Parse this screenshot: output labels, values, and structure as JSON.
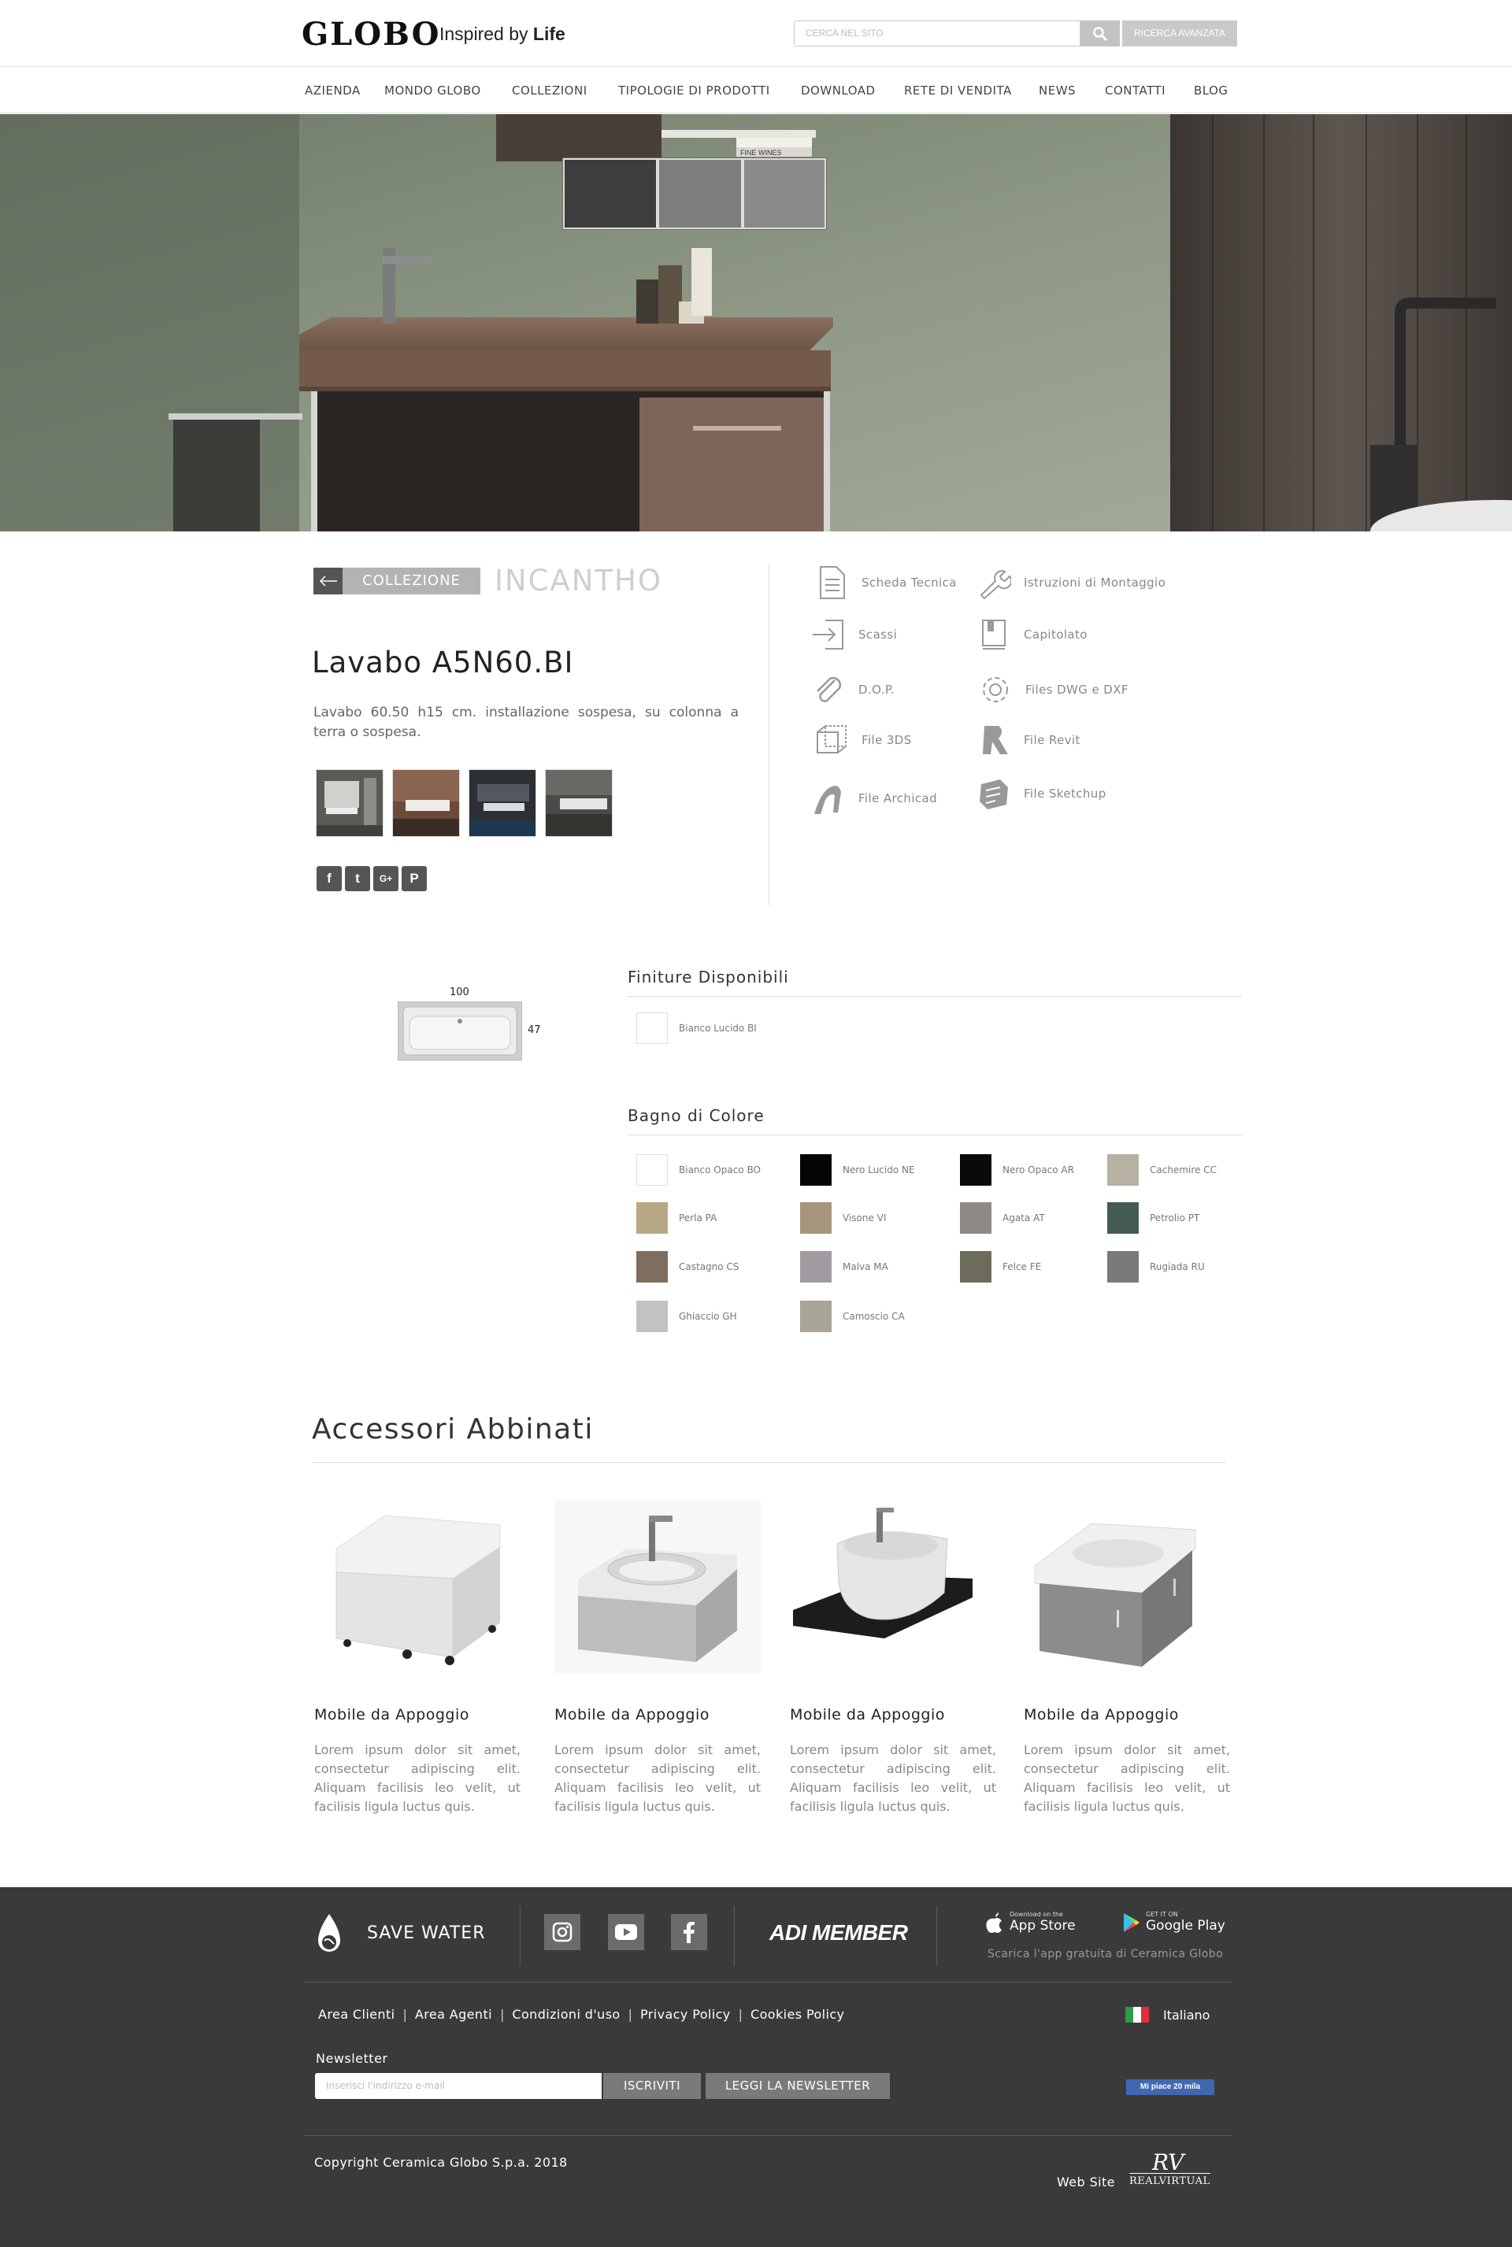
{
  "header": {
    "logo": "GLOBO",
    "tagline_prefix": "Inspired by",
    "tagline_bold": "Life",
    "search_placeholder": "CERCA NEL SITO",
    "advanced_search": "RICERCA AVANZATA"
  },
  "nav": {
    "items": [
      "AZIENDA",
      "MONDO GLOBO",
      "COLLEZIONI",
      "TIPOLOGIE DI PRODOTTI",
      "DOWNLOAD",
      "RETE DI VENDITA",
      "NEWS",
      "CONTATTI",
      "BLOG"
    ]
  },
  "hero": {
    "book_label": "FINE WINES"
  },
  "product": {
    "collection_label": "COLLEZIONE",
    "collection_name": "INCANTHO",
    "title": "Lavabo A5N60.BI",
    "description": "Lavabo 60.50 h15 cm. installazione sospesa, su colonna a terra o sospesa.",
    "share": [
      "f",
      "t",
      "G+",
      "P"
    ]
  },
  "downloads": {
    "items": [
      {
        "label": "Scheda Tecnica",
        "icon": "document-icon"
      },
      {
        "label": "Istruzioni di Montaggio",
        "icon": "wrench-icon"
      },
      {
        "label": "Scassi",
        "icon": "login-arrow-icon"
      },
      {
        "label": "Capitolato",
        "icon": "book-icon"
      },
      {
        "label": "D.O.P.",
        "icon": "paperclip-icon"
      },
      {
        "label": "Files DWG e DXF",
        "icon": "gear-icon"
      },
      {
        "label": "File 3DS",
        "icon": "cube-icon"
      },
      {
        "label": "File Revit",
        "icon": "revit-icon"
      },
      {
        "label": "File Archicad",
        "icon": "archicad-icon"
      },
      {
        "label": "File Sketchup",
        "icon": "sketchup-icon"
      }
    ]
  },
  "dimensions": {
    "width": "100",
    "depth": "47"
  },
  "finishes": {
    "title": "Finiture Disponibili",
    "items": [
      {
        "name": "Bianco Lucido BI",
        "color": "#ffffff"
      }
    ]
  },
  "colors": {
    "title": "Bagno di Colore",
    "items": [
      {
        "name": "Bianco Opaco BO",
        "color": "#ffffff"
      },
      {
        "name": "Nero Lucido NE",
        "color": "#050505"
      },
      {
        "name": "Nero Opaco AR",
        "color": "#0a0a0a"
      },
      {
        "name": "Cachemire CC",
        "color": "#b7b1a4"
      },
      {
        "name": "Perla PA",
        "color": "#b9a888"
      },
      {
        "name": "Visone VI",
        "color": "#a6957a"
      },
      {
        "name": "Agata AT",
        "color": "#8c8986"
      },
      {
        "name": "Petrolio PT",
        "color": "#455b55"
      },
      {
        "name": "Castagno CS",
        "color": "#7f6d5f"
      },
      {
        "name": "Malva MA",
        "color": "#a09ba1"
      },
      {
        "name": "Felce FE",
        "color": "#6c6b5c"
      },
      {
        "name": "Rugiada RU",
        "color": "#7a7a7b"
      },
      {
        "name": "Ghiaccio GH",
        "color": "#c2c2c0"
      },
      {
        "name": "Camoscio CA",
        "color": "#a8a596"
      }
    ]
  },
  "accessories": {
    "title": "Accessori Abbinati",
    "items": [
      {
        "name": "Mobile da Appoggio",
        "text": "Lorem ipsum dolor sit amet, consectetur adipiscing elit. Aliquam facilisis leo velit, ut facilisis ligula luctus quis."
      },
      {
        "name": "Mobile da Appoggio",
        "text": "Lorem ipsum dolor sit amet, consectetur adipiscing elit. Aliquam facilisis leo velit, ut facilisis ligula luctus quis."
      },
      {
        "name": "Mobile da Appoggio",
        "text": "Lorem ipsum dolor sit amet, consectetur adipiscing elit. Aliquam facilisis leo velit, ut facilisis ligula luctus quis."
      },
      {
        "name": "Mobile da Appoggio",
        "text": "Lorem ipsum dolor sit amet, consectetur adipiscing elit. Aliquam facilisis leo velit, ut facilisis ligula luctus quis."
      }
    ]
  },
  "footer": {
    "save_water": "SAVE WATER",
    "adi_member": "ADI MEMBER",
    "app_store_small": "Download on the",
    "app_store_big": "App Store",
    "google_play_small": "GET IT ON",
    "google_play_big": "Google Play",
    "app_note": "Scarica l'app gratuita di Ceramica Globo",
    "links": [
      "Area Clienti",
      "Area Agenti",
      "Condizioni d'uso",
      "Privacy Policy",
      "Cookies Policy"
    ],
    "language": "Italiano",
    "newsletter_label": "Newsletter",
    "newsletter_placeholder": "Inserisci l'indirizzo e-mail",
    "subscribe_label": "ISCRIVITI",
    "read_newsletter_label": "LEGGI LA NEWSLETTER",
    "fb_like": "Mi piace 20 mila",
    "copyright": "Copyright Ceramica Globo S.p.a. 2018",
    "website_label": "Web Site",
    "agency": "REALVIRTUAL"
  }
}
